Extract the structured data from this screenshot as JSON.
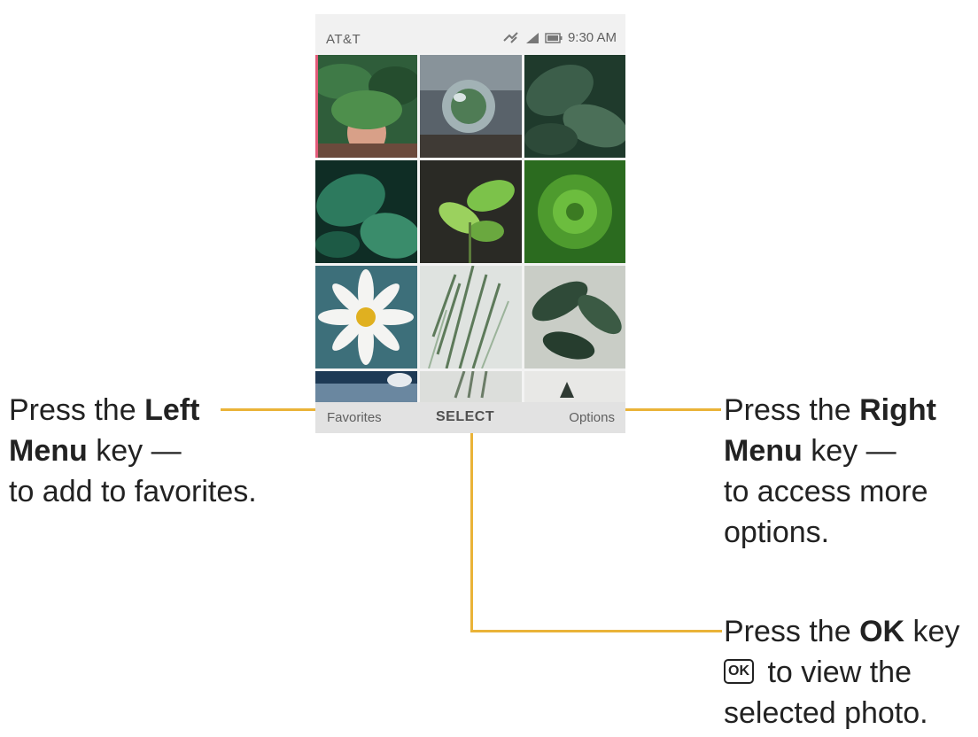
{
  "status_bar": {
    "carrier": "AT&T",
    "time": "9:30 AM",
    "icons": [
      "no-sim-icon",
      "signal-icon",
      "battery-icon"
    ]
  },
  "gallery": {
    "photos": [
      {
        "subject": "woman-with-leaf"
      },
      {
        "subject": "glass-sphere"
      },
      {
        "subject": "dark-leaves"
      },
      {
        "subject": "monstera-leaves"
      },
      {
        "subject": "seedling"
      },
      {
        "subject": "green-plant"
      },
      {
        "subject": "daisy"
      },
      {
        "subject": "palm-frond"
      },
      {
        "subject": "houseplant"
      },
      {
        "subject": "partial-photo"
      },
      {
        "subject": "partial-photo"
      },
      {
        "subject": "partial-photo"
      }
    ]
  },
  "softkeys": {
    "left": "Favorites",
    "center": "SELECT",
    "right": "Options"
  },
  "callouts": {
    "left": {
      "pre": "Press the ",
      "key": "Left",
      "line2_key": "Menu",
      "line2_rest": " key —",
      "line3": "to add to favorites."
    },
    "right": {
      "pre": "Press the ",
      "key": "Right",
      "line2_key": "Menu",
      "line2_rest": " key  —",
      "line3": "to access more",
      "line4": "options."
    },
    "center": {
      "pre": "Press the ",
      "key": "OK",
      "post": " key",
      "ok_glyph": "OK",
      "line2": " to view the",
      "line3": "selected photo."
    }
  },
  "colors": {
    "callout_line": "#eab338",
    "softkey_bar": "#e2e2e2"
  }
}
